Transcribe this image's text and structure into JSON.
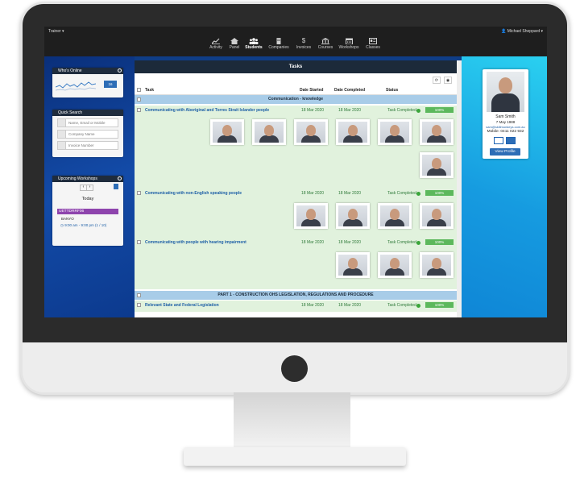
{
  "topbar": {
    "role_menu": "Trainer ▾",
    "user_menu": "Michael Sheppard ▾"
  },
  "nav": [
    {
      "label": "Activity",
      "icon": "chart-icon"
    },
    {
      "label": "Panel",
      "icon": "home-icon"
    },
    {
      "label": "Students",
      "icon": "users-icon",
      "active": true
    },
    {
      "label": "Companies",
      "icon": "building-icon"
    },
    {
      "label": "Invoices",
      "icon": "dollar-icon"
    },
    {
      "label": "Courses",
      "icon": "bank-icon"
    },
    {
      "label": "Workshops",
      "icon": "calendar-icon"
    },
    {
      "label": "Classes",
      "icon": "id-card-icon"
    }
  ],
  "whos_online": {
    "title": "Who's Online",
    "badge": "16"
  },
  "quick_search": {
    "title": "Quick Search",
    "name_placeholder": "Name, Email or Mobile",
    "company_placeholder": "Company Name",
    "invoice_placeholder": "Invoice Number"
  },
  "upcoming": {
    "title": "Upcoming Workshops",
    "day": "Today",
    "code": "UETTDRRF06",
    "location": "BANYO",
    "time": "9:00 am - 9:00 pm (1 / 10)"
  },
  "tasks": {
    "title": "Tasks",
    "columns": {
      "task": "Task",
      "started": "Date Started",
      "completed": "Date Completed",
      "status": "Status"
    },
    "sections": [
      {
        "label": "Communication - knowledge"
      },
      {
        "label": "PART 1 - CONSTRUCTION OHS LEGISLATION, REGULATIONS AND PROCEDURE"
      }
    ],
    "rows": [
      {
        "name": "Communicating with Aboriginal and Torres Strait Islander people",
        "started": "18 Mar 2020",
        "completed": "18 Mar 2020",
        "status": "Task Completed",
        "progress": "100%"
      },
      {
        "name": "Communicating with non-English speaking people",
        "started": "18 Mar 2020",
        "completed": "18 Mar 2020",
        "status": "Task Completed",
        "progress": "100%"
      },
      {
        "name": "Communicating with people with hearing impairment",
        "started": "18 Mar 2020",
        "completed": "18 Mar 2020",
        "status": "Task Completed",
        "progress": "100%"
      },
      {
        "name": "Relevant State and Federal Legislation",
        "started": "18 Mar 2020",
        "completed": "18 Mar 2020",
        "status": "Task Completed",
        "progress": "100%"
      }
    ]
  },
  "profile": {
    "name": "Sam Smith",
    "dob": "7 May 1988",
    "email": "sam@skillmonkeys.com.au",
    "mobile": "Mobile: 0411 022 932",
    "button": "View Profile"
  },
  "colors": {
    "accent": "#2d6db6",
    "success": "#5cb85c",
    "header": "#1c2a3a",
    "section": "#a8cce8",
    "row": "#e1f2dd"
  }
}
